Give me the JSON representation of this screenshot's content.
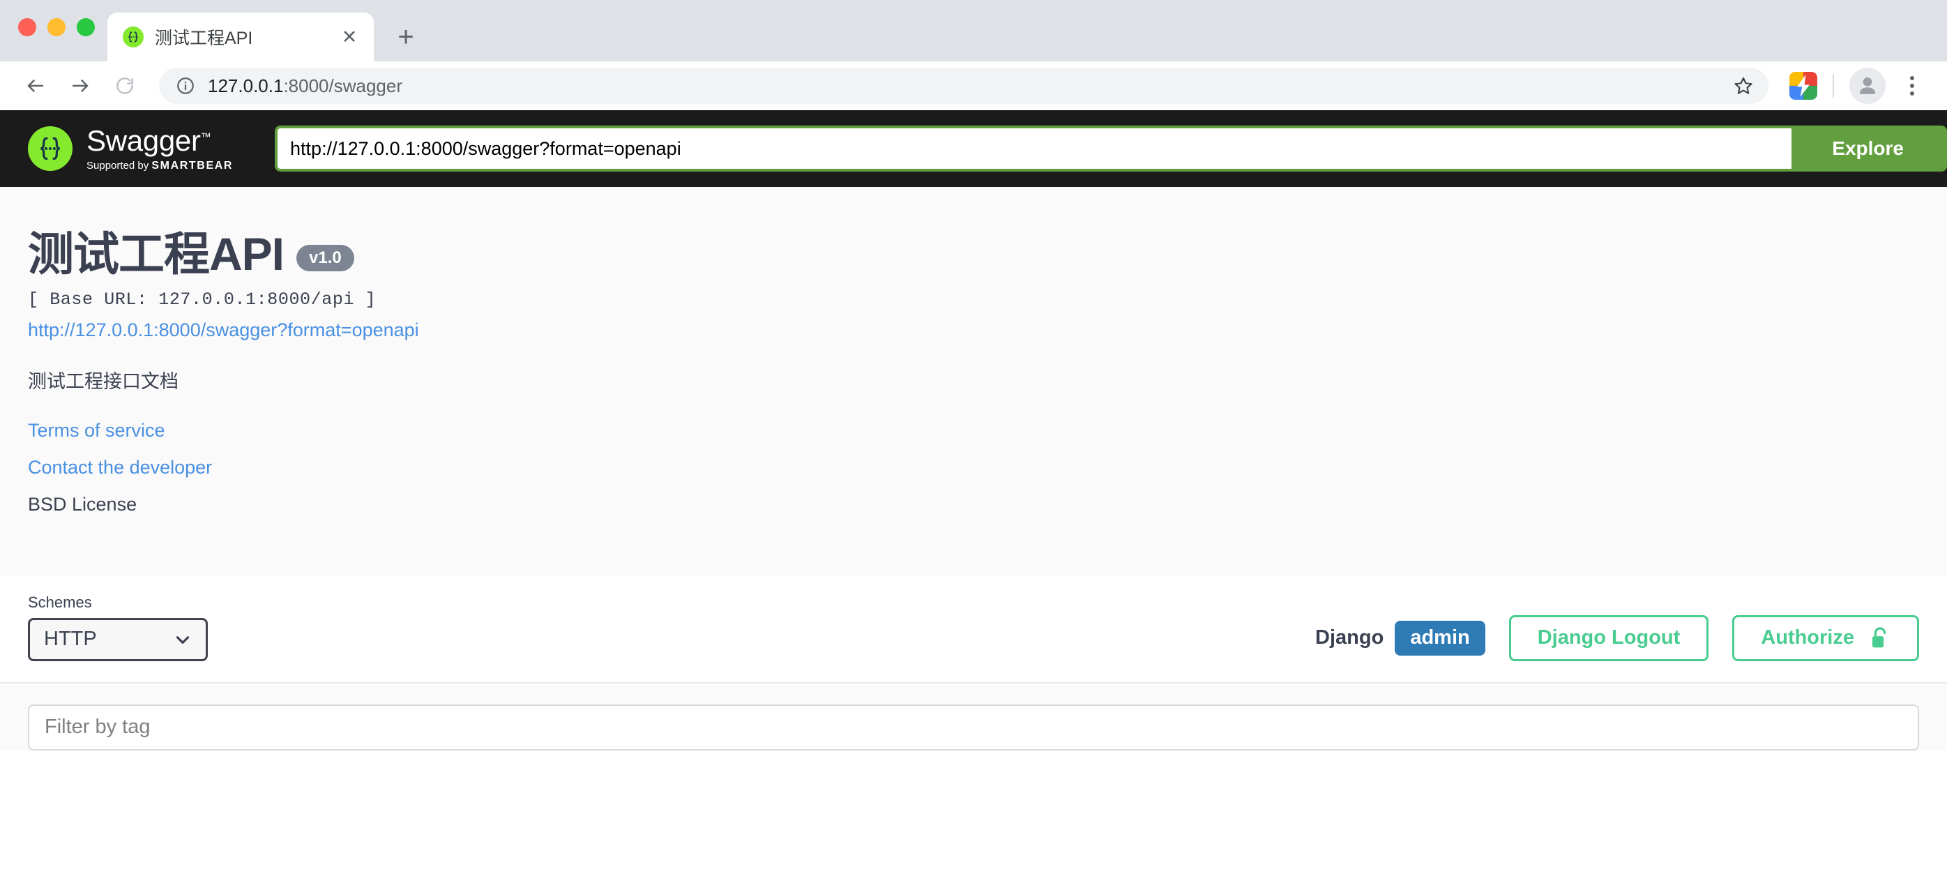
{
  "browser": {
    "tab": {
      "title": "测试工程API",
      "favicon_icon": "swagger-braces-icon",
      "close_icon": "close-icon"
    },
    "new_tab_icon": "plus-icon",
    "nav": {
      "back_icon": "arrow-left-icon",
      "forward_icon": "arrow-right-icon",
      "reload_icon": "reload-icon"
    },
    "omnibox": {
      "info_icon": "info-circle-icon",
      "url_host": "127.0.0.1",
      "url_path": ":8000/swagger",
      "star_icon": "bookmark-star-icon"
    },
    "extension_icon": "google-lightning-extension-icon",
    "avatar_icon": "profile-avatar-icon",
    "menu_icon": "kebab-menu-icon"
  },
  "topbar": {
    "logo_mark_icon": "swagger-braces-icon",
    "wordmark": "Swagger",
    "wordmark_tm": "™",
    "supported_by_prefix": "Supported by ",
    "supported_by_brand": "SMARTBEAR",
    "url_value": "http://127.0.0.1:8000/swagger?format=openapi",
    "url_placeholder": "http://127.0.0.1:8000/swagger?format=openapi",
    "explore_label": "Explore"
  },
  "info": {
    "title": "测试工程API",
    "version": "v1.0",
    "base_url": "[ Base URL: 127.0.0.1:8000/api ]",
    "spec_link": "http://127.0.0.1:8000/swagger?format=openapi",
    "description": "测试工程接口文档",
    "terms_label": "Terms of service",
    "contact_label": "Contact the developer",
    "license_label": "BSD License"
  },
  "schemes": {
    "label": "Schemes",
    "selected": "HTTP",
    "chevron_icon": "chevron-down-icon"
  },
  "auth": {
    "django_label": "Django",
    "django_user": "admin",
    "logout_label": "Django Logout",
    "authorize_label": "Authorize",
    "lock_icon": "unlocked-padlock-icon"
  },
  "filter": {
    "placeholder": "Filter by tag",
    "value": ""
  },
  "colors": {
    "swagger_green": "#85ea2d",
    "explore_green": "#62a03f",
    "authorize_green": "#49cc90",
    "link_blue": "#4990e2",
    "django_blue": "#2e7bb5",
    "text_slate": "#3b4151",
    "version_grey": "#7d8492",
    "topbar_dark": "#1b1b1b"
  }
}
